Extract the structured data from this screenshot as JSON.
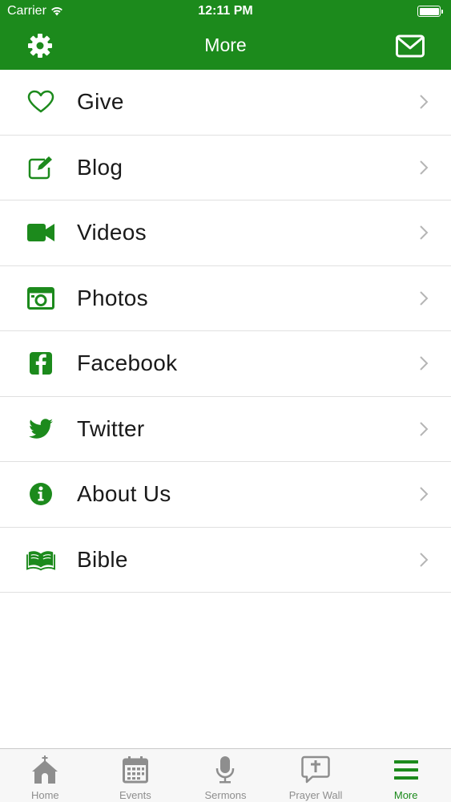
{
  "status_bar": {
    "carrier": "Carrier",
    "time": "12:11 PM"
  },
  "nav": {
    "title": "More",
    "left_icon": "gear-icon",
    "right_icon": "mail-icon"
  },
  "menu": [
    {
      "label": "Give",
      "icon": "heart-icon"
    },
    {
      "label": "Blog",
      "icon": "edit-icon"
    },
    {
      "label": "Videos",
      "icon": "video-camera-icon"
    },
    {
      "label": "Photos",
      "icon": "camera-icon"
    },
    {
      "label": "Facebook",
      "icon": "facebook-icon"
    },
    {
      "label": "Twitter",
      "icon": "twitter-icon"
    },
    {
      "label": "About Us",
      "icon": "info-icon"
    },
    {
      "label": "Bible",
      "icon": "book-icon"
    }
  ],
  "tabs": [
    {
      "label": "Home",
      "icon": "church-icon"
    },
    {
      "label": "Events",
      "icon": "calendar-icon"
    },
    {
      "label": "Sermons",
      "icon": "microphone-icon"
    },
    {
      "label": "Prayer Wall",
      "icon": "prayer-bubble-icon"
    },
    {
      "label": "More",
      "icon": "menu-icon",
      "active": true
    }
  ],
  "colors": {
    "brand": "#1c8a1c",
    "inactive": "#8e8e8e"
  }
}
